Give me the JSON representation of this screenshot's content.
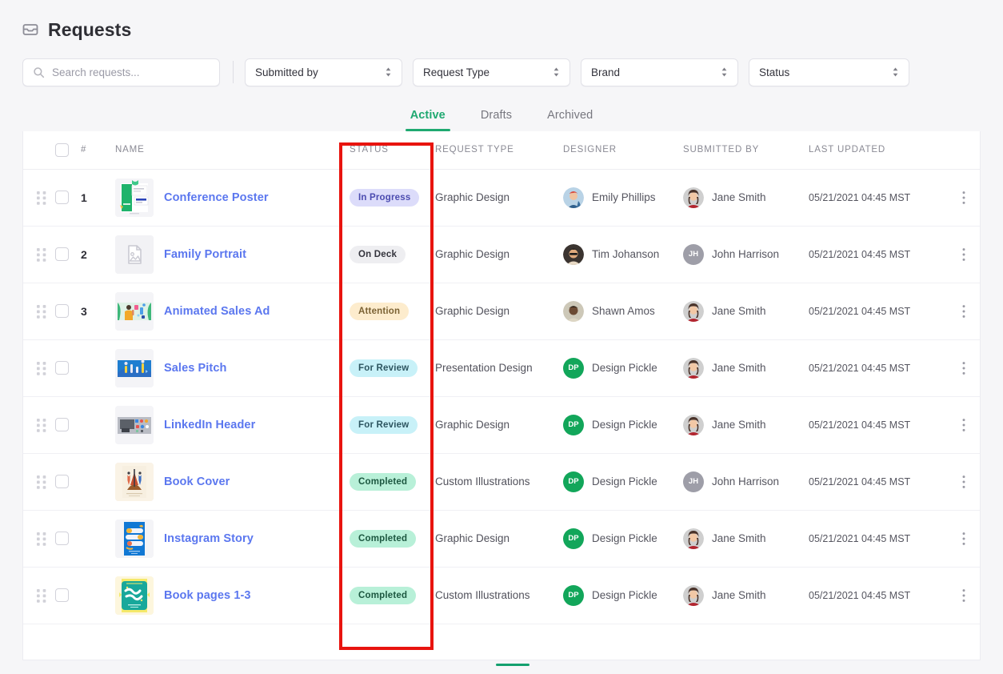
{
  "header": {
    "title": "Requests",
    "icon": "inbox-envelope-icon"
  },
  "search": {
    "placeholder": "Search requests...",
    "value": "",
    "icon": "search-icon"
  },
  "filters": [
    {
      "name": "submitted-by",
      "label": "Submitted by"
    },
    {
      "name": "request-type",
      "label": "Request Type"
    },
    {
      "name": "brand",
      "label": "Brand"
    },
    {
      "name": "status",
      "label": "Status"
    }
  ],
  "tabs": [
    {
      "label": "Active",
      "active": true
    },
    {
      "label": "Drafts",
      "active": false
    },
    {
      "label": "Archived",
      "active": false
    }
  ],
  "table": {
    "columns": [
      "#",
      "NAME",
      "STATUS",
      "REQUEST TYPE",
      "DESIGNER",
      "SUBMITTED BY",
      "LAST UPDATED"
    ],
    "rows": [
      {
        "num": "1",
        "name": "Conference Poster",
        "status": "In Progress",
        "status_bg": "#dcdcfa",
        "status_fg": "#4b4bb0",
        "type": "Graphic Design",
        "designer": "Emily Phillips",
        "designer_avatar": "photo",
        "submitted_by": "Jane Smith",
        "submitted_avatar": "photo",
        "updated": "05/21/2021 04:45 MST",
        "thumb": "conference-poster-thumbnail"
      },
      {
        "num": "2",
        "name": "Family Portrait",
        "status": "On Deck",
        "status_bg": "#eeeef1",
        "status_fg": "#33333c",
        "type": "Graphic Design",
        "designer": "Tim Johanson",
        "designer_avatar": "photo",
        "submitted_by": "John Harrison",
        "submitted_avatar": "JH",
        "updated": "05/21/2021 04:45 MST",
        "thumb": "placeholder-image-icon"
      },
      {
        "num": "3",
        "name": "Animated Sales Ad",
        "status": "Attention",
        "status_bg": "#fdeccd",
        "status_fg": "#7b6234",
        "type": "Graphic Design",
        "designer": "Shawn Amos",
        "designer_avatar": "photo",
        "submitted_by": "Jane Smith",
        "submitted_avatar": "photo",
        "updated": "05/21/2021 04:45 MST",
        "thumb": "animated-sales-ad-thumbnail"
      },
      {
        "num": "",
        "name": "Sales Pitch",
        "status": "For Review",
        "status_bg": "#c8f1f8",
        "status_fg": "#2d5560",
        "type": "Presentation Design",
        "designer": "Design Pickle",
        "designer_avatar": "DP",
        "submitted_by": "Jane Smith",
        "submitted_avatar": "photo",
        "updated": "05/21/2021 04:45 MST",
        "thumb": "sales-pitch-thumbnail"
      },
      {
        "num": "",
        "name": "LinkedIn Header",
        "status": "For Review",
        "status_bg": "#c8f1f8",
        "status_fg": "#2d5560",
        "type": "Graphic Design",
        "designer": "Design Pickle",
        "designer_avatar": "DP",
        "submitted_by": "Jane Smith",
        "submitted_avatar": "photo",
        "updated": "05/21/2021 04:45 MST",
        "thumb": "linkedin-header-thumbnail"
      },
      {
        "num": "",
        "name": "Book Cover",
        "status": "Completed",
        "status_bg": "#b8f0d8",
        "status_fg": "#1c5740",
        "type": "Custom Illustrations",
        "designer": "Design Pickle",
        "designer_avatar": "DP",
        "submitted_by": "John Harrison",
        "submitted_avatar": "JH",
        "updated": "05/21/2021 04:45 MST",
        "thumb": "book-cover-thumbnail"
      },
      {
        "num": "",
        "name": "Instagram Story",
        "status": "Completed",
        "status_bg": "#b8f0d8",
        "status_fg": "#1c5740",
        "type": "Graphic Design",
        "designer": "Design Pickle",
        "designer_avatar": "DP",
        "submitted_by": "Jane Smith",
        "submitted_avatar": "photo",
        "updated": "05/21/2021 04:45 MST",
        "thumb": "instagram-story-thumbnail"
      },
      {
        "num": "",
        "name": "Book pages 1-3",
        "status": "Completed",
        "status_bg": "#b8f0d8",
        "status_fg": "#1c5740",
        "type": "Custom Illustrations",
        "designer": "Design Pickle",
        "designer_avatar": "DP",
        "submitted_by": "Jane Smith",
        "submitted_avatar": "photo",
        "updated": "05/21/2021 04:45 MST",
        "thumb": "book-pages-thumbnail"
      }
    ]
  },
  "annotation": {
    "name": "status-column-highlight",
    "color": "#e8140f"
  },
  "theme": {
    "accent_green": "#1fa971",
    "link_blue": "#5b77ef",
    "dp_green": "#12a65a"
  }
}
